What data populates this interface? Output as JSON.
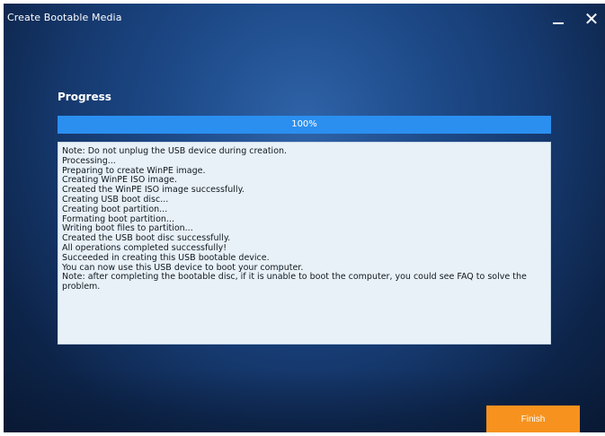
{
  "window": {
    "title": "Create Bootable Media",
    "minimize_label": "_",
    "close_label": "✕"
  },
  "progress": {
    "heading": "Progress",
    "percent": 100,
    "percent_label": "100%"
  },
  "log": {
    "lines": [
      "Note: Do not unplug the USB device during creation.",
      "Processing...",
      "Preparing to create WinPE image.",
      "Creating WinPE ISO image.",
      "Created the WinPE ISO image successfully.",
      "Creating USB boot disc...",
      "Creating boot partition...",
      "Formating boot partition...",
      "Writing boot files to partition...",
      "Created the USB boot disc successfully.",
      "All operations completed successfully!",
      "Succeeded in creating this USB bootable device.",
      "You can now use this USB device to boot your computer.",
      "Note: after completing the bootable disc, if it is unable to boot the computer, you could see FAQ to solve the problem."
    ]
  },
  "footer": {
    "finish_label": "Finish"
  },
  "colors": {
    "accent_orange": "#f7921e",
    "progress_blue": "#2b8ff0",
    "log_background": "#e9f1f8"
  }
}
